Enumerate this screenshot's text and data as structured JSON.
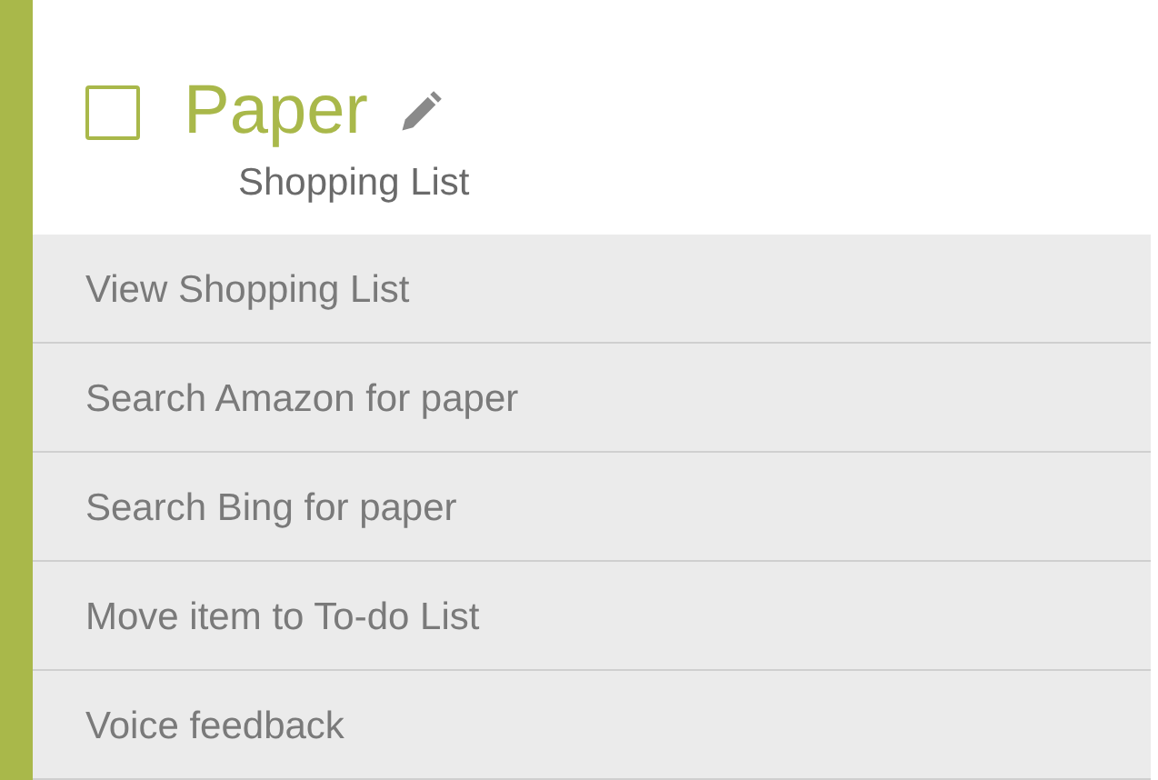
{
  "item": {
    "title": "Paper",
    "checked": false,
    "list": "Shopping List"
  },
  "menu": [
    {
      "label": "View Shopping List"
    },
    {
      "label": "Search Amazon for paper"
    },
    {
      "label": "Search Bing for paper"
    },
    {
      "label": "Move item to To-do List"
    },
    {
      "label": "Voice feedback"
    }
  ]
}
